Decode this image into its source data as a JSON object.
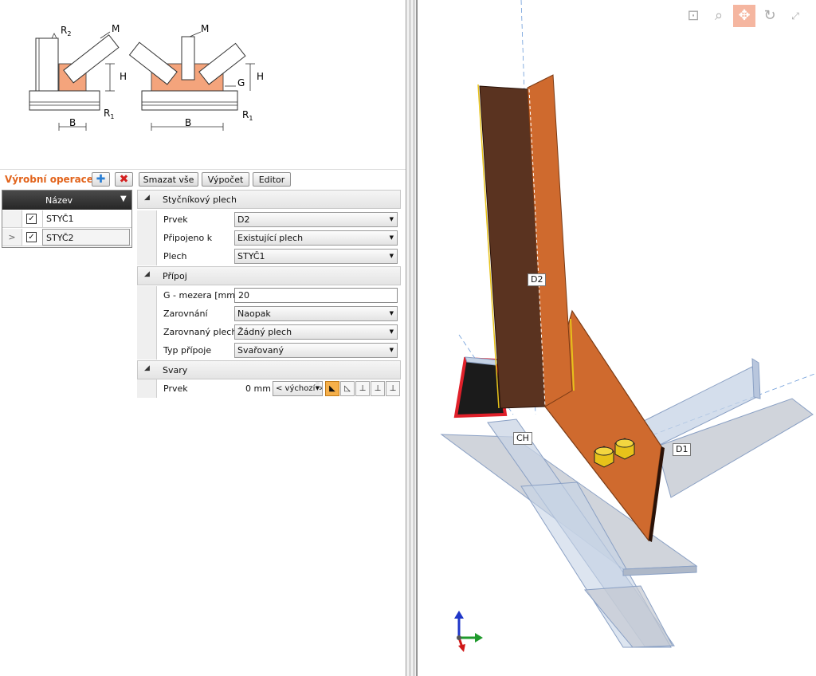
{
  "diagram": {
    "labels": {
      "r2": "R",
      "r2_sub": "2",
      "m_left": "M",
      "m_right": "M",
      "h_left": "H",
      "h_right": "H",
      "g": "G",
      "r1_left": "R",
      "r1_left_sub": "1",
      "r1_right": "R",
      "r1_right_sub": "1",
      "b_left": "B",
      "b_right": "B"
    }
  },
  "operations": {
    "title": "Výrobní operace",
    "delete_all": "Smazat vše",
    "compute": "Výpočet",
    "editor": "Editor",
    "grid_header": "Název",
    "rows": [
      {
        "name": "STYČ1",
        "checked": true,
        "selected": false,
        "indicator": ""
      },
      {
        "name": "STYČ2",
        "checked": true,
        "selected": true,
        "indicator": ">"
      }
    ]
  },
  "properties": {
    "sec_plate": "Styčníkový plech",
    "element_label": "Prvek",
    "element_value": "D2",
    "connected_label": "Připojeno k",
    "connected_value": "Existující plech",
    "plate_label": "Plech",
    "plate_value": "STYČ1",
    "sec_joint": "Přípoj",
    "gap_label": "G - mezera [mm]",
    "gap_value": "20",
    "align_label": "Zarovnání",
    "align_value": "Naopak",
    "aligned_plate_label": "Zarovnaný plech",
    "aligned_plate_value": "Žádný plech",
    "joint_type_label": "Typ přípoje",
    "joint_type_value": "Svařovaný",
    "sec_welds": "Svary",
    "weld_label": "Prvek",
    "weld_size": "0 mm",
    "weld_default": "< výchozí >"
  },
  "viewport": {
    "labels": {
      "d2": "D2",
      "ch": "CH",
      "d1": "D1"
    },
    "colors": {
      "plate": "#cf6a2e",
      "plate_dark": "#5a3320",
      "member": "#c6d3e6",
      "bolt": "#e7c21a",
      "cut": "#e0202a"
    }
  }
}
